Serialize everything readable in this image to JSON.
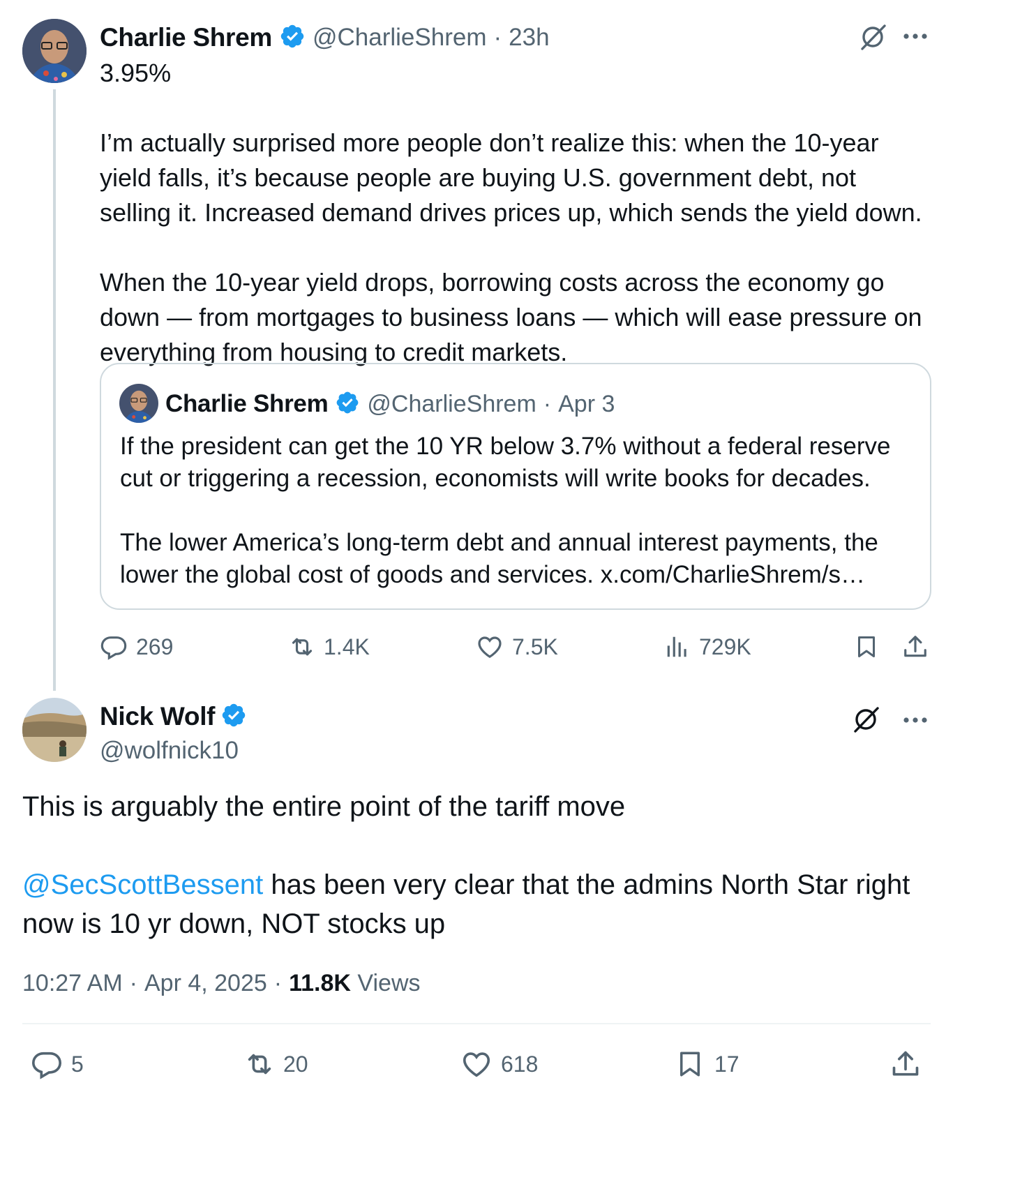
{
  "parent_tweet": {
    "author_name": "Charlie Shrem",
    "handle": "@CharlieShrem",
    "time": "23h",
    "separator": "·",
    "text": "3.95%\n\nI’m actually surprised more people don’t realize this: when the 10-year yield falls, it’s because people are buying U.S. government debt, not selling it. Increased demand drives prices up, which sends the yield down.\n\nWhen the 10-year yield drops, borrowing costs across the economy go down — from mortgages to business loans — which will ease pressure on everything from housing to credit markets.",
    "quote": {
      "author_name": "Charlie Shrem",
      "handle": "@CharlieShrem",
      "date": "Apr 3",
      "separator": "·",
      "text": "If the president can get the 10 YR below 3.7% without a federal reserve cut or triggering a recession, economists will write books for decades.\n\nThe lower America’s long-term debt and annual interest payments, the lower the global cost of goods and services. x.com/CharlieShrem/s…"
    },
    "actions": {
      "replies": "269",
      "reposts": "1.4K",
      "likes": "7.5K",
      "views": "729K"
    }
  },
  "reply_tweet": {
    "author_name": "Nick Wolf",
    "handle": "@wolfnick10",
    "text_line1": "This is arguably the entire point of the tariff move",
    "mention": "@SecScottBessent",
    "text_line2": " has been very clear that the admins North Star right now is 10 yr down, NOT stocks up",
    "time": "10:27 AM",
    "date": "Apr 4, 2025",
    "separator": "·",
    "views_count": "11.8K",
    "views_label": "Views",
    "actions": {
      "replies": "5",
      "reposts": "20",
      "likes": "618",
      "bookmarks": "17"
    }
  },
  "colors": {
    "accent": "#1d9bf0",
    "text_primary": "#0f1419",
    "text_secondary": "#536471",
    "border": "#cfd9de"
  },
  "icons": [
    "grok-icon",
    "more-icon",
    "verified-badge-icon",
    "reply-icon",
    "repost-icon",
    "like-icon",
    "views-icon",
    "bookmark-icon",
    "share-icon"
  ]
}
